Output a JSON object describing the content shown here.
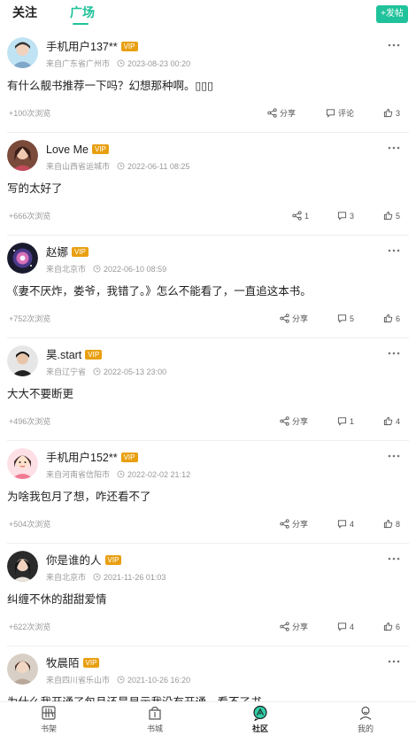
{
  "header": {
    "tabs": [
      {
        "label": "关注",
        "active": false
      },
      {
        "label": "广场",
        "active": true
      }
    ],
    "post_button": "+发帖",
    "accent_color": "#1fc29a"
  },
  "vip_label": "VIP",
  "posts": [
    {
      "user": "手机用户137**",
      "location": "来自广东省广州市",
      "time": "2023-08-23 00:20",
      "content": "有什么靓书推荐一下吗？幻想那种啊。▯▯▯",
      "views": "+100次浏览",
      "share": "分享",
      "comment": "评论",
      "likes": "3"
    },
    {
      "user": "Love Me",
      "location": "来自山西省运城市",
      "time": "2022-06-11 08:25",
      "content": "写的太好了",
      "views": "+666次浏览",
      "share": "1",
      "comment": "3",
      "likes": "5"
    },
    {
      "user": "赵娜",
      "location": "来自北京市",
      "time": "2022-06-10 08:59",
      "content": "《妻不厌炸，娄爷，我错了。》怎么不能看了，一直追这本书。",
      "views": "+752次浏览",
      "share": "分享",
      "comment": "5",
      "likes": "6"
    },
    {
      "user": "昊.start",
      "location": "来自辽宁省",
      "time": "2022-05-13 23:00",
      "content": "大大不要断更",
      "views": "+496次浏览",
      "share": "分享",
      "comment": "1",
      "likes": "4"
    },
    {
      "user": "手机用户152**",
      "location": "来自河南省信阳市",
      "time": "2022-02-02 21:12",
      "content": "为啥我包月了想，咋还看不了",
      "views": "+504次浏览",
      "share": "分享",
      "comment": "4",
      "likes": "8"
    },
    {
      "user": "你是谁的人",
      "location": "来自北京市",
      "time": "2021-11-26 01:03",
      "content": "纠缠不休的甜甜爱情",
      "views": "+622次浏览",
      "share": "分享",
      "comment": "4",
      "likes": "6"
    },
    {
      "user": "牧晨陌",
      "location": "来自四川省乐山市",
      "time": "2021-10-26 16:20",
      "content": "为什么我开通了包月还是显示我没有开通，看不了书",
      "views": "",
      "share": "",
      "comment": "",
      "likes": ""
    }
  ],
  "bottom_nav": [
    {
      "label": "书架",
      "icon": "bookshelf-icon",
      "active": false
    },
    {
      "label": "书城",
      "icon": "bookstore-icon",
      "active": false
    },
    {
      "label": "社区",
      "icon": "community-icon",
      "active": true
    },
    {
      "label": "我的",
      "icon": "profile-icon",
      "active": false
    }
  ]
}
